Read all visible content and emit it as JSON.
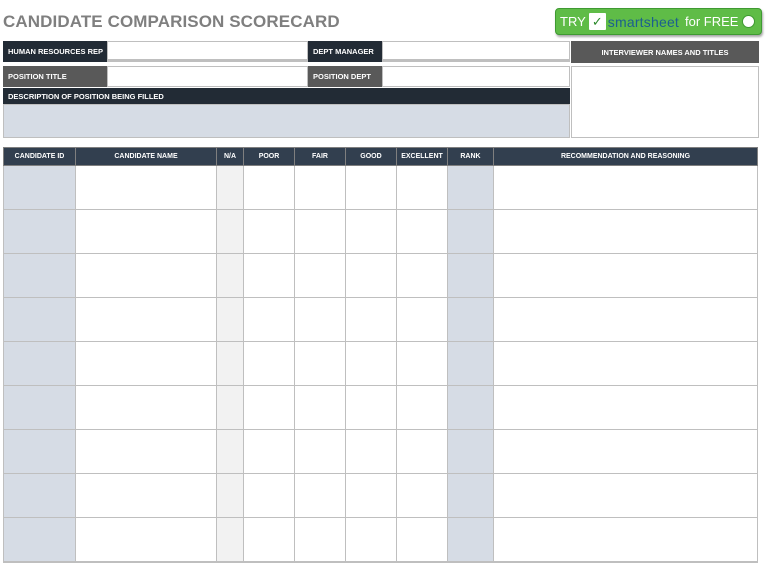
{
  "title": "CANDIDATE COMPARISON SCORECARD",
  "cta": {
    "try": "TRY",
    "check": "✓",
    "brand": "smartsheet",
    "free": "for FREE"
  },
  "header_fields": {
    "hr_rep_label": "HUMAN RESOURCES REP",
    "hr_rep_value": "",
    "dept_manager_label": "DEPT MANAGER",
    "dept_manager_value": "",
    "interviewers_label": "INTERVIEWER NAMES AND TITLES",
    "interviewers_value": "",
    "position_title_label": "POSITION TITLE",
    "position_title_value": "",
    "position_dept_label": "POSITION DEPT",
    "position_dept_value": "",
    "description_label": "DESCRIPTION OF POSITION BEING FILLED",
    "description_value": ""
  },
  "table": {
    "columns": [
      "CANDIDATE ID",
      "CANDIDATE NAME",
      "N/A",
      "POOR",
      "FAIR",
      "GOOD",
      "EXCELLENT",
      "RANK",
      "RECOMMENDATION AND REASONING"
    ],
    "rows": [
      [
        "",
        "",
        "",
        "",
        "",
        "",
        "",
        "",
        ""
      ],
      [
        "",
        "",
        "",
        "",
        "",
        "",
        "",
        "",
        ""
      ],
      [
        "",
        "",
        "",
        "",
        "",
        "",
        "",
        "",
        ""
      ],
      [
        "",
        "",
        "",
        "",
        "",
        "",
        "",
        "",
        ""
      ],
      [
        "",
        "",
        "",
        "",
        "",
        "",
        "",
        "",
        ""
      ],
      [
        "",
        "",
        "",
        "",
        "",
        "",
        "",
        "",
        ""
      ],
      [
        "",
        "",
        "",
        "",
        "",
        "",
        "",
        "",
        ""
      ],
      [
        "",
        "",
        "",
        "",
        "",
        "",
        "",
        "",
        ""
      ],
      [
        "",
        "",
        "",
        "",
        "",
        "",
        "",
        "",
        ""
      ]
    ]
  },
  "colors": {
    "header_dark": "#222b35",
    "header_gray": "#595959",
    "table_header": "#323f4f",
    "shade_blue": "#d6dce5",
    "shade_gray": "#f2f2f2",
    "cta_green": "#5fbc47"
  }
}
